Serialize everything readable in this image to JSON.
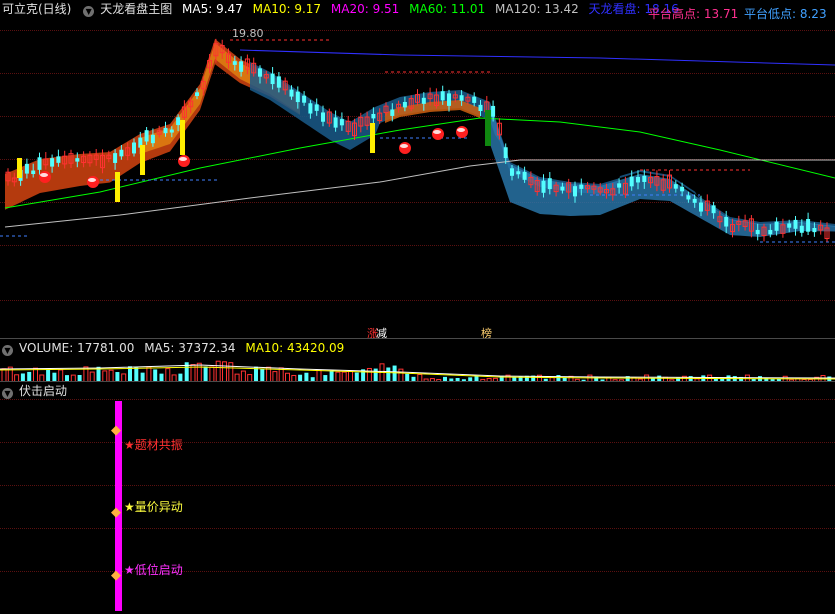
{
  "header": {
    "stock_title": "可立克(日线)",
    "indicator_name": "天龙看盘主图",
    "ma5": "MA5: 9.47",
    "ma10": "MA10: 9.17",
    "ma20": "MA20: 9.51",
    "ma60": "MA60: 11.01",
    "ma120": "MA120: 13.42",
    "tianlong": "天龙看盘: 18.16",
    "platform_high": "平台高点: 13.71",
    "platform_low": "平台低点: 8.23"
  },
  "price_chart": {
    "peak_label": "19.80",
    "tag_a": "涨",
    "tag_b": "减",
    "tag_c": "榜"
  },
  "volume_panel": {
    "label": "VOLUME: 17781.00",
    "ma5": "MA5: 37372.34",
    "ma10": "MA10: 43420.09"
  },
  "signal_panel": {
    "title": "伏击启动",
    "signals": [
      {
        "text": "题材共振",
        "color": "#ff3030"
      },
      {
        "text": "量价异动",
        "color": "#ffff40"
      },
      {
        "text": "低位启动",
        "color": "#ff30ff"
      }
    ]
  },
  "colors": {
    "ma5": "#ffffff",
    "ma10": "#ffff00",
    "ma20": "#ff00ff",
    "ma60": "#00ff00",
    "ma120": "#c0c0c0",
    "tianlong": "#3030ff",
    "platform_high": "#ff3090",
    "platform_low": "#40a0ff",
    "up_candle": "#ff3232",
    "down_candle": "#54ffff"
  }
}
